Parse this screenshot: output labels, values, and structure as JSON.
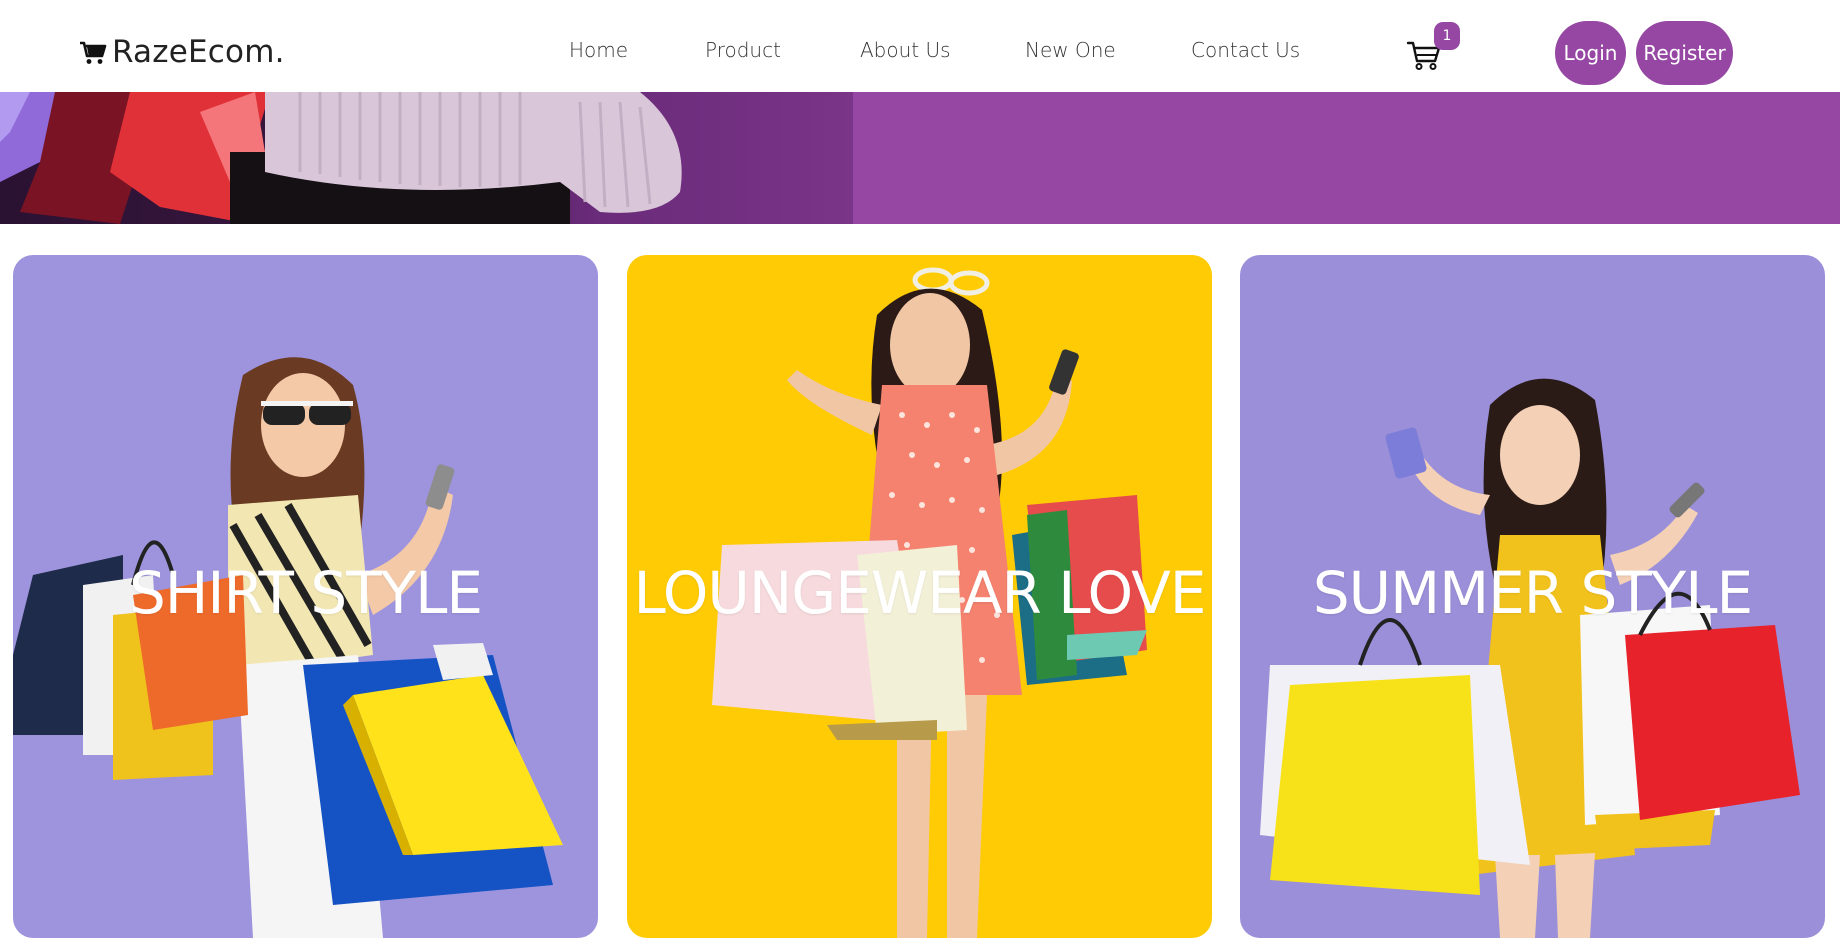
{
  "header": {
    "logo_text": "RazeEcom.",
    "logo_icon": "cart-icon",
    "nav": [
      {
        "label": "Home"
      },
      {
        "label": "Product"
      },
      {
        "label": "About Us"
      },
      {
        "label": "New One"
      },
      {
        "label": "Contact Us"
      }
    ],
    "cart_icon": "shopping-cart-icon",
    "cart_count": "1",
    "login_label": "Login",
    "register_label": "Register"
  },
  "colors": {
    "accent": "#9547a3",
    "card_purple": "#9d94dd",
    "card_yellow": "#fecb05"
  },
  "categories": [
    {
      "title": "SHIRT STYLE"
    },
    {
      "title": "LOUNGEWEAR LOVE"
    },
    {
      "title": "SUMMER STYLE"
    }
  ]
}
